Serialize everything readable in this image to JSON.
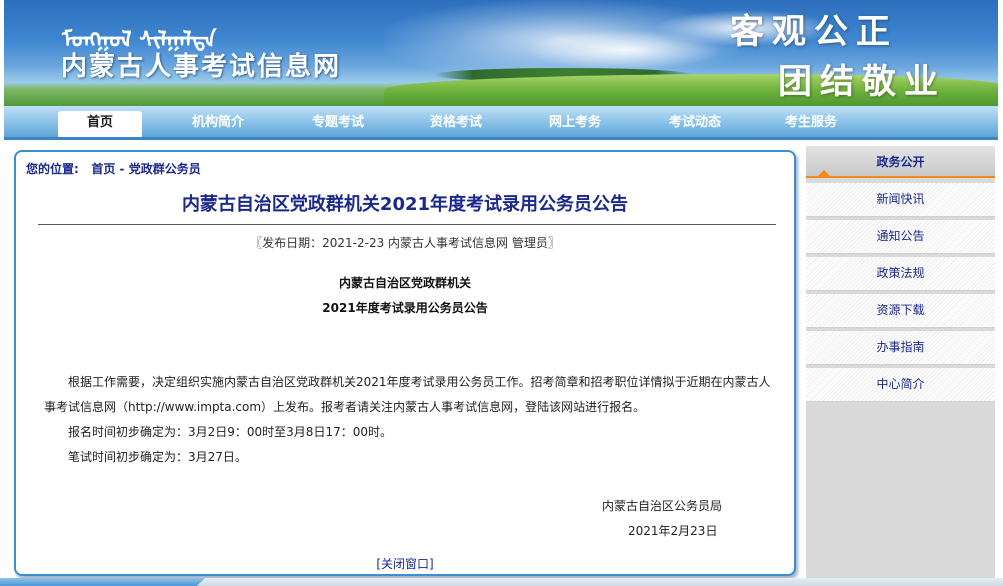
{
  "header": {
    "mongolian_text": "ᠮᠣᠩᠭᠣᠯ ᠰᠢᠯᠭᠠᠯᠲᠠ",
    "site_title": "内蒙古人事考试信息网",
    "slogan_line1": "客观公正",
    "slogan_line2": "团结敬业"
  },
  "nav": {
    "items": [
      {
        "label": "首页",
        "active": true
      },
      {
        "label": "机构简介",
        "active": false
      },
      {
        "label": "专题考试",
        "active": false
      },
      {
        "label": "资格考试",
        "active": false
      },
      {
        "label": "网上考务",
        "active": false
      },
      {
        "label": "考试动态",
        "active": false
      },
      {
        "label": "考生服务",
        "active": false
      }
    ]
  },
  "breadcrumb": {
    "prefix": "您的位置:",
    "home": "首页",
    "separator": " - ",
    "current": "党政群公务员"
  },
  "article": {
    "title": "内蒙古自治区党政群机关2021年度考试录用公务员公告",
    "meta": "〖发布日期：2021-2-23 内蒙古人事考试信息网 管理员〗",
    "heading_line1": "内蒙古自治区党政群机关",
    "heading_line2": "2021年度考试录用公务员公告",
    "paragraph1": "根据工作需要，决定组织实施内蒙古自治区党政群机关2021年度考试录用公务员工作。招考简章和招考职位详情拟于近期在内蒙古人事考试信息网（http://www.impta.com）上发布。报考者请关注内蒙古人事考试信息网，登陆该网站进行报名。",
    "paragraph2": "报名时间初步确定为：3月2日9：00时至3月8日17：00时。",
    "paragraph3": "笔试时间初步确定为：3月27日。",
    "signature_org": "内蒙古自治区公务员局",
    "signature_date": "2021年2月23日",
    "close_window": "[关闭窗口]"
  },
  "sidebar": {
    "header": "政务公开",
    "items": [
      "新闻快讯",
      "通知公告",
      "政策法规",
      "资源下载",
      "办事指南",
      "中心简介"
    ]
  },
  "colors": {
    "nav_text": "#ffffff",
    "link_blue": "#1b2a8a",
    "panel_border": "#3b8fcf",
    "sidebar_accent": "#f28a1b"
  }
}
